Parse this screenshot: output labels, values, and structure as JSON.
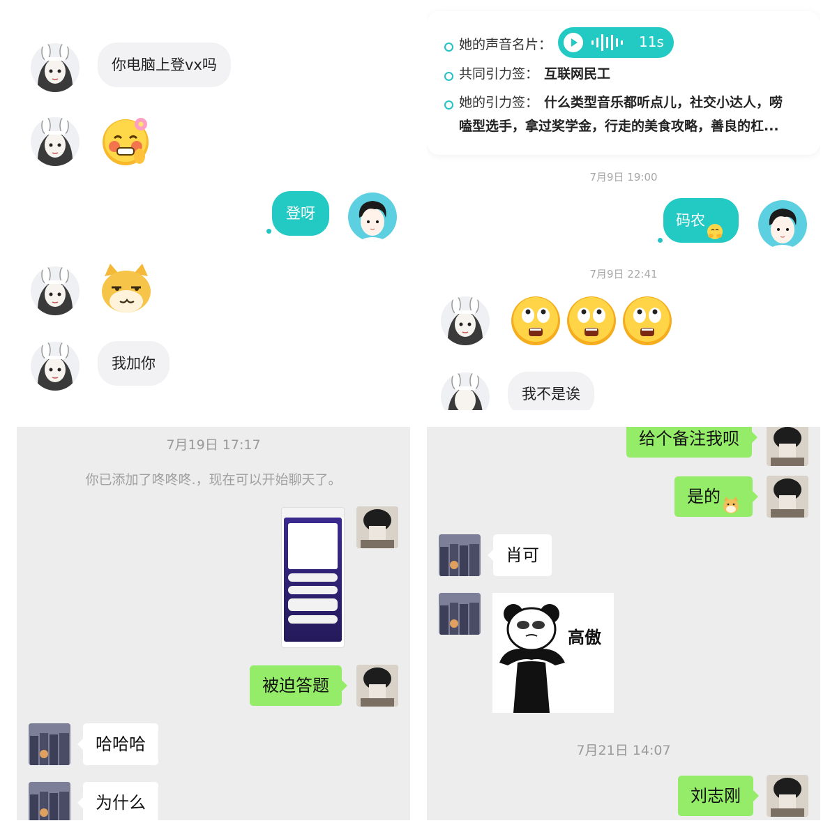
{
  "panel1": {
    "messages": [
      {
        "text": "你电脑上登vx吗"
      },
      {
        "text": "登呀"
      },
      {
        "text": "我加你"
      }
    ]
  },
  "panel2": {
    "profile": {
      "voice_label": "她的声音名片：",
      "voice_duration": "11s",
      "common_label": "共同引力签：",
      "common_value": "互联网民工",
      "her_label": "她的引力签：",
      "her_value_line1": "什么类型音乐都听点儿，社交小达人，唠",
      "her_value_line2": "嗑型选手，拿过奖学金，行走的美食攻略，善良的杠..."
    },
    "time1": "7月9日 19:00",
    "msg_out": "码农",
    "time2": "7月9日 22:41",
    "msg_in": "我不是诶"
  },
  "panel3": {
    "time": "7月19日 17:17",
    "system": "你已添加了咚咚咚.，现在可以开始聊天了。",
    "msg_out": "被迫答题",
    "msg_in1": "哈哈哈",
    "msg_in2": "为什么"
  },
  "panel4": {
    "msg_out1": "给个备注我呗",
    "msg_out2": "是的",
    "msg_in1": "肖可",
    "sticker_text": "高傲",
    "time": "7月21日 14:07",
    "msg_out3": "刘志刚"
  },
  "colors": {
    "soul_accent": "#23c9c3",
    "wechat_green": "#95ec69",
    "wechat_bg": "#ededed"
  }
}
